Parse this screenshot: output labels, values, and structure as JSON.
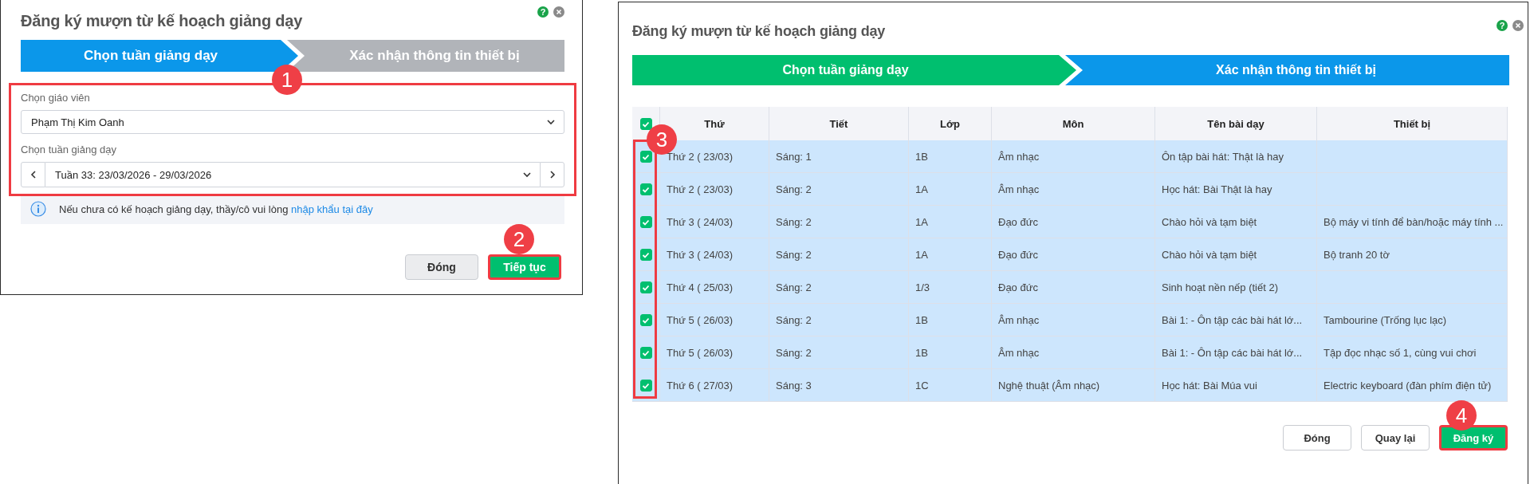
{
  "dialogs": [
    {
      "title": "Đăng ký mượn từ kế hoạch giảng dạy",
      "help": "?",
      "steps": [
        {
          "label": "Chọn tuần giảng dạy",
          "selected": true
        },
        {
          "label": "Xác nhận thông tin thiết bị",
          "selected": false,
          "done": false
        }
      ],
      "form": {
        "highlighted": true,
        "callout": "1",
        "fields": [
          {
            "kind": "select",
            "label": "Chọn giáo viên",
            "value": "Phạm Thị Kim Oanh"
          },
          {
            "kind": "stepper",
            "label": "Chọn tuần giảng dạy",
            "value": "Tuần 33: 23/03/2026 - 29/03/2026"
          }
        ]
      },
      "notice": {
        "text": "Nếu chưa có kế hoạch giảng dạy, thầy/cô vui lòng",
        "link": "nhập khẩu tại đây"
      },
      "buttons": [
        {
          "label": "Đóng",
          "kind": "secondary",
          "highlighted": false
        },
        {
          "label": "Tiếp tục",
          "kind": "primary",
          "highlighted": true,
          "callout": "2"
        }
      ]
    },
    {
      "title": "Đăng ký mượn từ kế hoạch giảng dạy",
      "help": "?",
      "steps": [
        {
          "label": "Chọn tuần giảng dạy",
          "selected": false,
          "done": true
        },
        {
          "label": "Xác nhận thông tin thiết bị",
          "selected": true
        }
      ],
      "table": {
        "all_checked": true,
        "checkbox_column_highlighted": true,
        "callout": "3",
        "columns": [
          "Thứ",
          "Tiết",
          "Lớp",
          "Môn",
          "Tên bài dạy",
          "Thiết bị"
        ],
        "rows": [
          {
            "checked": true,
            "cells": [
              "Thứ 2 ( 23/03)",
              "Sáng: 1",
              "1B",
              "Âm nhạc",
              "Ôn tập bài hát: Thật là hay",
              null
            ]
          },
          {
            "checked": true,
            "cells": [
              "Thứ 2 ( 23/03)",
              "Sáng: 2",
              "1A",
              "Âm nhạc",
              "Học hát: Bài Thật là hay",
              null
            ]
          },
          {
            "checked": true,
            "cells": [
              "Thứ 3 ( 24/03)",
              "Sáng: 2",
              "1A",
              "Đạo đức",
              "Chào hỏi và tạm biệt",
              "Bộ máy vi tính để bàn/hoặc máy tính ..."
            ]
          },
          {
            "checked": true,
            "cells": [
              "Thứ 3 ( 24/03)",
              "Sáng: 2",
              "1A",
              "Đạo đức",
              "Chào hỏi và tạm biệt",
              "Bộ tranh 20 tờ"
            ]
          },
          {
            "checked": true,
            "cells": [
              "Thứ 4 ( 25/03)",
              "Sáng: 2",
              "1/3",
              "Đạo đức",
              "Sinh hoạt nền nếp (tiết 2)",
              null
            ]
          },
          {
            "checked": true,
            "cells": [
              "Thứ 5 ( 26/03)",
              "Sáng: 2",
              "1B",
              "Âm nhạc",
              "Bài 1: - Ôn tập các bài hát lớ...",
              "Tambourine (Trống lục lạc)"
            ]
          },
          {
            "checked": true,
            "cells": [
              "Thứ 5 ( 26/03)",
              "Sáng: 2",
              "1B",
              "Âm nhạc",
              "Bài 1: - Ôn tập các bài hát lớ...",
              "Tập đọc nhạc số 1, cùng vui chơi"
            ]
          },
          {
            "checked": true,
            "cells": [
              "Thứ 6 ( 27/03)",
              "Sáng: 3",
              "1C",
              "Nghệ thuật (Âm nhạc)",
              "Học hát: Bài Múa vui",
              "Electric keyboard (đàn phím điện tử)"
            ]
          }
        ]
      },
      "buttons": [
        {
          "label": "Đóng",
          "kind": "secondary",
          "highlighted": false
        },
        {
          "label": "Quay lại",
          "kind": "secondary",
          "highlighted": false
        },
        {
          "label": "Đăng ký",
          "kind": "primary",
          "highlighted": true,
          "callout": "4"
        }
      ]
    }
  ]
}
